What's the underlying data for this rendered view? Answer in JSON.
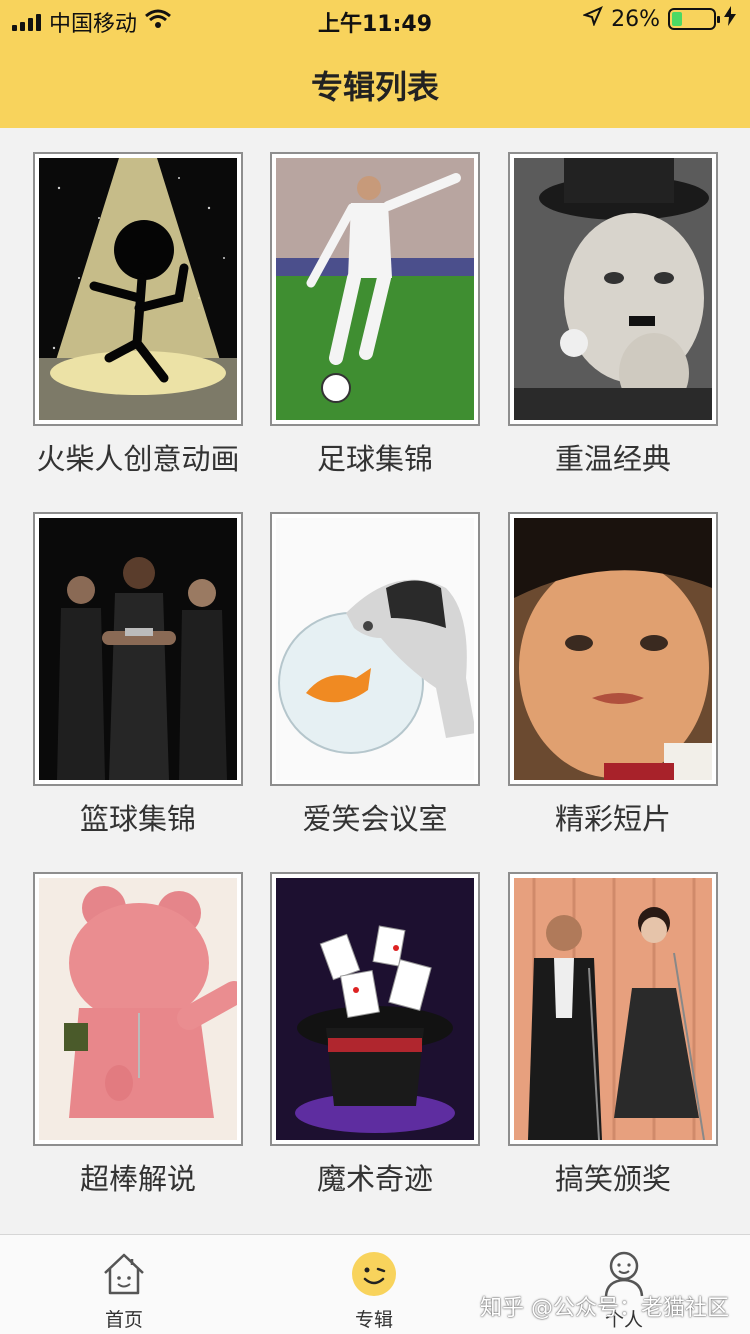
{
  "status_bar": {
    "carrier": "中国移动",
    "time": "上午11:49",
    "battery_percent": "26%",
    "battery_level": 0.26,
    "battery_color": "#4cd964"
  },
  "nav": {
    "title": "专辑列表",
    "background": "#f8d35c"
  },
  "albums": [
    {
      "title": "火柴人创意动画",
      "thumb_icon": "stickman-spotlight-image"
    },
    {
      "title": "足球集锦",
      "thumb_icon": "soccer-player-image"
    },
    {
      "title": "重温经典",
      "thumb_icon": "chaplin-portrait-image"
    },
    {
      "title": "篮球集锦",
      "thumb_icon": "basketball-players-image"
    },
    {
      "title": "爱笑会议室",
      "thumb_icon": "cat-fishbowl-image"
    },
    {
      "title": "精彩短片",
      "thumb_icon": "child-face-image"
    },
    {
      "title": "超棒解说",
      "thumb_icon": "pink-bear-figure-image"
    },
    {
      "title": "魔术奇迹",
      "thumb_icon": "magic-hat-cards-image"
    },
    {
      "title": "搞笑颁奖",
      "thumb_icon": "award-hosts-image"
    }
  ],
  "tabbar": {
    "tabs": [
      {
        "label": "首页",
        "icon": "home-icon",
        "active": false
      },
      {
        "label": "专辑",
        "icon": "smiley-icon",
        "active": true
      },
      {
        "label": "个人",
        "icon": "person-icon",
        "active": false
      }
    ],
    "active_color": "#f8d35c"
  },
  "watermark": "知乎 @公众号：老猫社区"
}
